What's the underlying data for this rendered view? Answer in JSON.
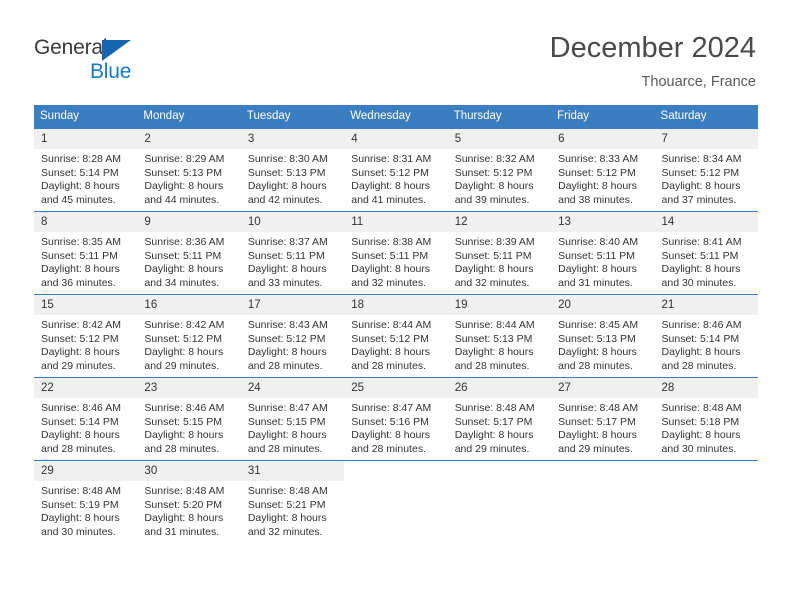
{
  "brand": {
    "name_part1": "General",
    "name_part2": "Blue",
    "triangle_color": "#1565b0",
    "blue_text_color": "#1878c8"
  },
  "header": {
    "title": "December 2024",
    "subtitle": "Thouarce, France"
  },
  "theme": {
    "header_blue": "#3a7dc0",
    "daynum_band": "#f0f0f0",
    "text": "#333333"
  },
  "weekday_headers": [
    "Sunday",
    "Monday",
    "Tuesday",
    "Wednesday",
    "Thursday",
    "Friday",
    "Saturday"
  ],
  "weeks": [
    [
      {
        "day": "1",
        "sunrise": "Sunrise: 8:28 AM",
        "sunset": "Sunset: 5:14 PM",
        "daylight1": "Daylight: 8 hours",
        "daylight2": "and 45 minutes."
      },
      {
        "day": "2",
        "sunrise": "Sunrise: 8:29 AM",
        "sunset": "Sunset: 5:13 PM",
        "daylight1": "Daylight: 8 hours",
        "daylight2": "and 44 minutes."
      },
      {
        "day": "3",
        "sunrise": "Sunrise: 8:30 AM",
        "sunset": "Sunset: 5:13 PM",
        "daylight1": "Daylight: 8 hours",
        "daylight2": "and 42 minutes."
      },
      {
        "day": "4",
        "sunrise": "Sunrise: 8:31 AM",
        "sunset": "Sunset: 5:12 PM",
        "daylight1": "Daylight: 8 hours",
        "daylight2": "and 41 minutes."
      },
      {
        "day": "5",
        "sunrise": "Sunrise: 8:32 AM",
        "sunset": "Sunset: 5:12 PM",
        "daylight1": "Daylight: 8 hours",
        "daylight2": "and 39 minutes."
      },
      {
        "day": "6",
        "sunrise": "Sunrise: 8:33 AM",
        "sunset": "Sunset: 5:12 PM",
        "daylight1": "Daylight: 8 hours",
        "daylight2": "and 38 minutes."
      },
      {
        "day": "7",
        "sunrise": "Sunrise: 8:34 AM",
        "sunset": "Sunset: 5:12 PM",
        "daylight1": "Daylight: 8 hours",
        "daylight2": "and 37 minutes."
      }
    ],
    [
      {
        "day": "8",
        "sunrise": "Sunrise: 8:35 AM",
        "sunset": "Sunset: 5:11 PM",
        "daylight1": "Daylight: 8 hours",
        "daylight2": "and 36 minutes."
      },
      {
        "day": "9",
        "sunrise": "Sunrise: 8:36 AM",
        "sunset": "Sunset: 5:11 PM",
        "daylight1": "Daylight: 8 hours",
        "daylight2": "and 34 minutes."
      },
      {
        "day": "10",
        "sunrise": "Sunrise: 8:37 AM",
        "sunset": "Sunset: 5:11 PM",
        "daylight1": "Daylight: 8 hours",
        "daylight2": "and 33 minutes."
      },
      {
        "day": "11",
        "sunrise": "Sunrise: 8:38 AM",
        "sunset": "Sunset: 5:11 PM",
        "daylight1": "Daylight: 8 hours",
        "daylight2": "and 32 minutes."
      },
      {
        "day": "12",
        "sunrise": "Sunrise: 8:39 AM",
        "sunset": "Sunset: 5:11 PM",
        "daylight1": "Daylight: 8 hours",
        "daylight2": "and 32 minutes."
      },
      {
        "day": "13",
        "sunrise": "Sunrise: 8:40 AM",
        "sunset": "Sunset: 5:11 PM",
        "daylight1": "Daylight: 8 hours",
        "daylight2": "and 31 minutes."
      },
      {
        "day": "14",
        "sunrise": "Sunrise: 8:41 AM",
        "sunset": "Sunset: 5:11 PM",
        "daylight1": "Daylight: 8 hours",
        "daylight2": "and 30 minutes."
      }
    ],
    [
      {
        "day": "15",
        "sunrise": "Sunrise: 8:42 AM",
        "sunset": "Sunset: 5:12 PM",
        "daylight1": "Daylight: 8 hours",
        "daylight2": "and 29 minutes."
      },
      {
        "day": "16",
        "sunrise": "Sunrise: 8:42 AM",
        "sunset": "Sunset: 5:12 PM",
        "daylight1": "Daylight: 8 hours",
        "daylight2": "and 29 minutes."
      },
      {
        "day": "17",
        "sunrise": "Sunrise: 8:43 AM",
        "sunset": "Sunset: 5:12 PM",
        "daylight1": "Daylight: 8 hours",
        "daylight2": "and 28 minutes."
      },
      {
        "day": "18",
        "sunrise": "Sunrise: 8:44 AM",
        "sunset": "Sunset: 5:12 PM",
        "daylight1": "Daylight: 8 hours",
        "daylight2": "and 28 minutes."
      },
      {
        "day": "19",
        "sunrise": "Sunrise: 8:44 AM",
        "sunset": "Sunset: 5:13 PM",
        "daylight1": "Daylight: 8 hours",
        "daylight2": "and 28 minutes."
      },
      {
        "day": "20",
        "sunrise": "Sunrise: 8:45 AM",
        "sunset": "Sunset: 5:13 PM",
        "daylight1": "Daylight: 8 hours",
        "daylight2": "and 28 minutes."
      },
      {
        "day": "21",
        "sunrise": "Sunrise: 8:46 AM",
        "sunset": "Sunset: 5:14 PM",
        "daylight1": "Daylight: 8 hours",
        "daylight2": "and 28 minutes."
      }
    ],
    [
      {
        "day": "22",
        "sunrise": "Sunrise: 8:46 AM",
        "sunset": "Sunset: 5:14 PM",
        "daylight1": "Daylight: 8 hours",
        "daylight2": "and 28 minutes."
      },
      {
        "day": "23",
        "sunrise": "Sunrise: 8:46 AM",
        "sunset": "Sunset: 5:15 PM",
        "daylight1": "Daylight: 8 hours",
        "daylight2": "and 28 minutes."
      },
      {
        "day": "24",
        "sunrise": "Sunrise: 8:47 AM",
        "sunset": "Sunset: 5:15 PM",
        "daylight1": "Daylight: 8 hours",
        "daylight2": "and 28 minutes."
      },
      {
        "day": "25",
        "sunrise": "Sunrise: 8:47 AM",
        "sunset": "Sunset: 5:16 PM",
        "daylight1": "Daylight: 8 hours",
        "daylight2": "and 28 minutes."
      },
      {
        "day": "26",
        "sunrise": "Sunrise: 8:48 AM",
        "sunset": "Sunset: 5:17 PM",
        "daylight1": "Daylight: 8 hours",
        "daylight2": "and 29 minutes."
      },
      {
        "day": "27",
        "sunrise": "Sunrise: 8:48 AM",
        "sunset": "Sunset: 5:17 PM",
        "daylight1": "Daylight: 8 hours",
        "daylight2": "and 29 minutes."
      },
      {
        "day": "28",
        "sunrise": "Sunrise: 8:48 AM",
        "sunset": "Sunset: 5:18 PM",
        "daylight1": "Daylight: 8 hours",
        "daylight2": "and 30 minutes."
      }
    ],
    [
      {
        "day": "29",
        "sunrise": "Sunrise: 8:48 AM",
        "sunset": "Sunset: 5:19 PM",
        "daylight1": "Daylight: 8 hours",
        "daylight2": "and 30 minutes."
      },
      {
        "day": "30",
        "sunrise": "Sunrise: 8:48 AM",
        "sunset": "Sunset: 5:20 PM",
        "daylight1": "Daylight: 8 hours",
        "daylight2": "and 31 minutes."
      },
      {
        "day": "31",
        "sunrise": "Sunrise: 8:48 AM",
        "sunset": "Sunset: 5:21 PM",
        "daylight1": "Daylight: 8 hours",
        "daylight2": "and 32 minutes."
      },
      {
        "day": "",
        "sunrise": "",
        "sunset": "",
        "daylight1": "",
        "daylight2": ""
      },
      {
        "day": "",
        "sunrise": "",
        "sunset": "",
        "daylight1": "",
        "daylight2": ""
      },
      {
        "day": "",
        "sunrise": "",
        "sunset": "",
        "daylight1": "",
        "daylight2": ""
      },
      {
        "day": "",
        "sunrise": "",
        "sunset": "",
        "daylight1": "",
        "daylight2": ""
      }
    ]
  ]
}
